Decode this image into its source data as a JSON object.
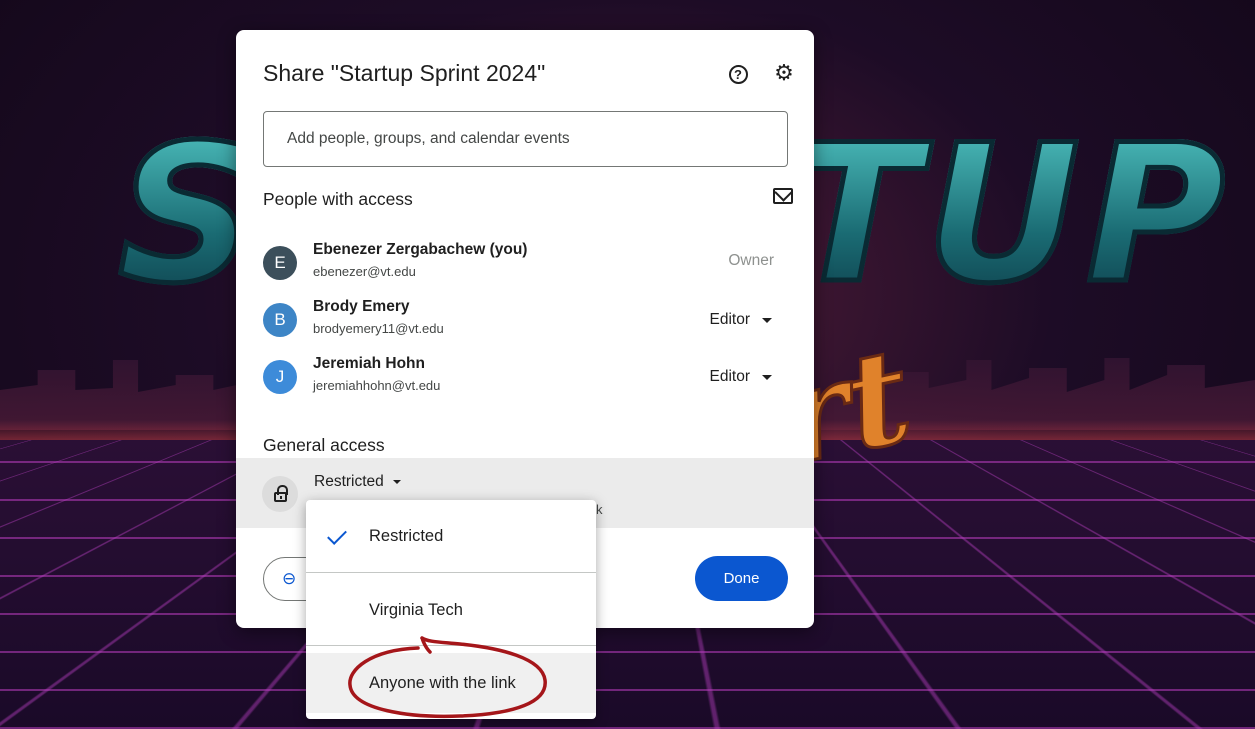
{
  "dialog": {
    "title": "Share \"Startup Sprint 2024\"",
    "add_placeholder": "Add people, groups, and calendar events",
    "people_section": "People with access",
    "general_section": "General access",
    "done_label": "Done"
  },
  "people": [
    {
      "initial": "E",
      "name": "Ebenezer Zergabachew (you)",
      "email": "ebenezer@vt.edu",
      "role": "Owner",
      "avatar_color": "#3c4f5b"
    },
    {
      "initial": "B",
      "name": "Brody Emery",
      "email": "brodyemery11@vt.edu",
      "role": "Editor",
      "avatar_color": "#3d85c6"
    },
    {
      "initial": "J",
      "name": "Jeremiah Hohn",
      "email": "jeremiahhohn@vt.edu",
      "role": "Editor",
      "avatar_color": "#3d8bd9"
    }
  ],
  "general_access": {
    "selected": "Restricted",
    "description_fragment": "k"
  },
  "menu": {
    "items": [
      {
        "label": "Restricted",
        "checked": true
      },
      {
        "label": "Virginia Tech",
        "checked": false
      },
      {
        "label": "Anyone with the link",
        "checked": false
      }
    ]
  },
  "icons": {
    "help": "help-circle-icon",
    "settings": "gear-icon",
    "email": "mail-icon",
    "lock": "lock-icon",
    "link": "link-icon",
    "check": "check-icon"
  },
  "colors": {
    "accent": "#0b57d0",
    "annotation": "#a5161a",
    "highlight_row": "#ebebeb"
  },
  "background": {
    "left_text": "S",
    "right_text": "TUP",
    "script_text": "rt"
  }
}
